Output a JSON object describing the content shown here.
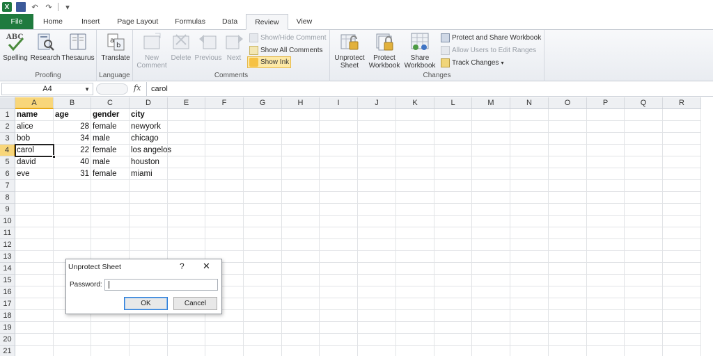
{
  "qat": {
    "logo": "X",
    "undo": "↶",
    "redo": "↷",
    "customize": "▾"
  },
  "tabs": [
    {
      "label": "File"
    },
    {
      "label": "Home"
    },
    {
      "label": "Insert"
    },
    {
      "label": "Page Layout"
    },
    {
      "label": "Formulas"
    },
    {
      "label": "Data"
    },
    {
      "label": "Review"
    },
    {
      "label": "View"
    }
  ],
  "ribbon": {
    "proofing": {
      "label": "Proofing",
      "spelling": "Spelling",
      "research": "Research",
      "thesaurus": "Thesaurus",
      "abc": "ABC"
    },
    "language": {
      "label": "Language",
      "translate": "Translate"
    },
    "comments": {
      "label": "Comments",
      "new_comment_1": "New",
      "new_comment_2": "Comment",
      "delete": "Delete",
      "previous": "Previous",
      "next": "Next",
      "show_hide": "Show/Hide Comment",
      "show_all": "Show All Comments",
      "show_ink": "Show Ink"
    },
    "changes": {
      "label": "Changes",
      "unprotect_sheet_1": "Unprotect",
      "unprotect_sheet_2": "Sheet",
      "protect_workbook_1": "Protect",
      "protect_workbook_2": "Workbook",
      "share_workbook_1": "Share",
      "share_workbook_2": "Workbook",
      "protect_share": "Protect and Share Workbook",
      "allow_users": "Allow Users to Edit Ranges",
      "track_changes": "Track Changes",
      "track_dd": "▾"
    }
  },
  "formula_bar": {
    "name_box": "A4",
    "name_dd": "▼",
    "fx": "fx",
    "content": "carol"
  },
  "columns": [
    "A",
    "B",
    "C",
    "D",
    "E",
    "F",
    "G",
    "H",
    "I",
    "J",
    "K",
    "L",
    "M",
    "N",
    "O",
    "P",
    "Q",
    "R"
  ],
  "rows": [
    "1",
    "2",
    "3",
    "4",
    "5",
    "6",
    "7",
    "8",
    "9",
    "10",
    "11",
    "12",
    "13",
    "14",
    "15",
    "16",
    "17",
    "18",
    "19",
    "20",
    "21"
  ],
  "sheet": {
    "header": {
      "a": "name",
      "b": "age",
      "c": "gender",
      "d": "city"
    },
    "r2": {
      "a": "alice",
      "b": "28",
      "c": "female",
      "d": "newyork"
    },
    "r3": {
      "a": "bob",
      "b": "34",
      "c": "male",
      "d": "chicago"
    },
    "r4": {
      "a": "carol",
      "b": "22",
      "c": "female",
      "d": "los angelos"
    },
    "r5": {
      "a": "david",
      "b": "40",
      "c": "male",
      "d": "houston"
    },
    "r6": {
      "a": "eve",
      "b": "31",
      "c": "female",
      "d": "miami"
    }
  },
  "active_cell": "A4",
  "dialog": {
    "title": "Unprotect Sheet",
    "help": "?",
    "close": "✕",
    "password_label": "Password:",
    "password_value": "",
    "ok": "OK",
    "cancel": "Cancel"
  },
  "colors": {
    "file_tab": "#1f7a3e",
    "selection_header": "#f8d67a",
    "show_ink_active": "#fde9a6"
  }
}
